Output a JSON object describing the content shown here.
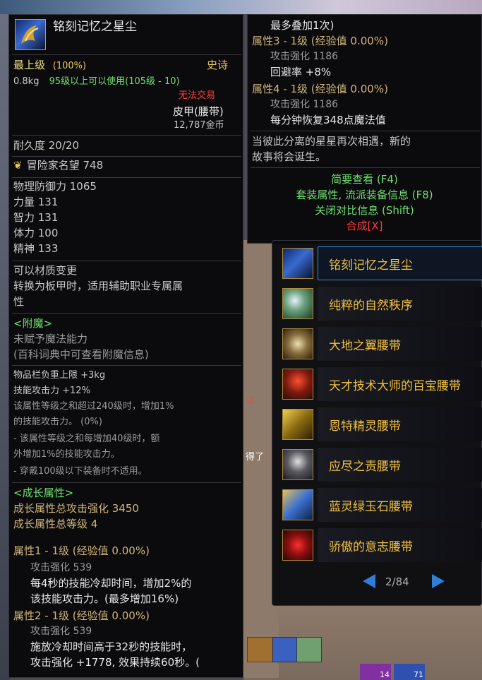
{
  "item": {
    "name": "铭刻记忆之星尘",
    "rarity_label": "最上级",
    "rarity_pct": "(100%)",
    "grade": "史诗",
    "weight": "0.8kg",
    "level_req": "95级以上可以使用(105级 - 10)",
    "trade": "无法交易",
    "type": "皮甲(腰带)",
    "price": "12,787金币",
    "durability": "耐久度 20/20",
    "reputation": "冒险家名望 748",
    "stats": [
      "物理防御力 1065",
      "力量 131",
      "智力 131",
      "体力 100",
      "精神 133"
    ],
    "material_change": "可以材质变更",
    "material_note_1": "转换为板甲时，适用辅助职业专属属",
    "material_note_2": "性",
    "enchant_header": "<附魔>",
    "enchant_none": "未赋予魔法能力",
    "enchant_hint": "(百科词典中可查看附魔信息)",
    "inventory_weight": "物品栏负重上限 +3kg",
    "skill_attack": "技能攻击力 +12%",
    "set_desc_1": "该属性等级之和超过240级时，增加1%",
    "set_desc_2": "的技能攻击力。 (0%)",
    "set_desc_3": "- 该属性等级之和每增加40级时，额",
    "set_desc_4": "外增加1%的技能攻击力。",
    "set_desc_5": "- 穿戴100级以下装备时不适用。",
    "growth_header": "<成长属性>",
    "growth_total_atk": "成长属性总攻击强化 3450",
    "growth_total_lv": "成长属性总等级 4",
    "attr1_header": "属性1 - 1级 (经验值 0.00%)",
    "attr1_atk": "攻击强化 539",
    "attr1_desc_1": "每4秒的技能冷却时间，增加2%的",
    "attr1_desc_2": "该技能攻击力。(最多增加16%)",
    "attr2_header": "属性2 - 1级 (经验值 0.00%)",
    "attr2_atk": "攻击强化 539",
    "attr2_desc_1": "施放冷却时间高于32秒的技能时，",
    "attr2_desc_2": "攻击强化 +1778, 效果持续60秒。("
  },
  "right": {
    "stack_note": "最多叠加1次)",
    "attr3_header": "属性3 - 1级 (经验值 0.00%)",
    "attr3_atk": "攻击强化 1186",
    "attr3_dodge": "回避率 +8%",
    "attr4_header": "属性4 - 1级 (经验值 0.00%)",
    "attr4_atk": "攻击强化 1186",
    "attr4_mp": "每分钟恢复348点魔法值",
    "flavor_1": "当彼此分离的星星再次相遇，新的",
    "flavor_2": "故事将会诞生。",
    "action_brief": "简要查看 (F4)",
    "action_set": "套装属性, 流派装备信息 (F8)",
    "action_compare": "关闭对比信息 (Shift)",
    "action_compose": "合成[X]"
  },
  "list": {
    "items": [
      {
        "label": "铭刻记忆之星尘"
      },
      {
        "label": "纯粹的自然秩序"
      },
      {
        "label": "大地之翼腰带"
      },
      {
        "label": "天才技术大师的百宝腰带"
      },
      {
        "label": "恩特精灵腰带"
      },
      {
        "label": "应尽之责腰带"
      },
      {
        "label": "蓝灵绿玉石腰带"
      },
      {
        "label": "骄傲的意志腰带"
      }
    ],
    "page": "2/84"
  },
  "background": {
    "side_text_1": "达",
    "side_text_2": "得了",
    "hotbar_count_1": "14",
    "hotbar_count_2": "71"
  },
  "colors": {
    "panel_bg": "#08080a",
    "gold": "#e8c85a",
    "green": "#6fe06f",
    "red": "#ff3b3b",
    "selected_border": "#2f8fe0"
  }
}
